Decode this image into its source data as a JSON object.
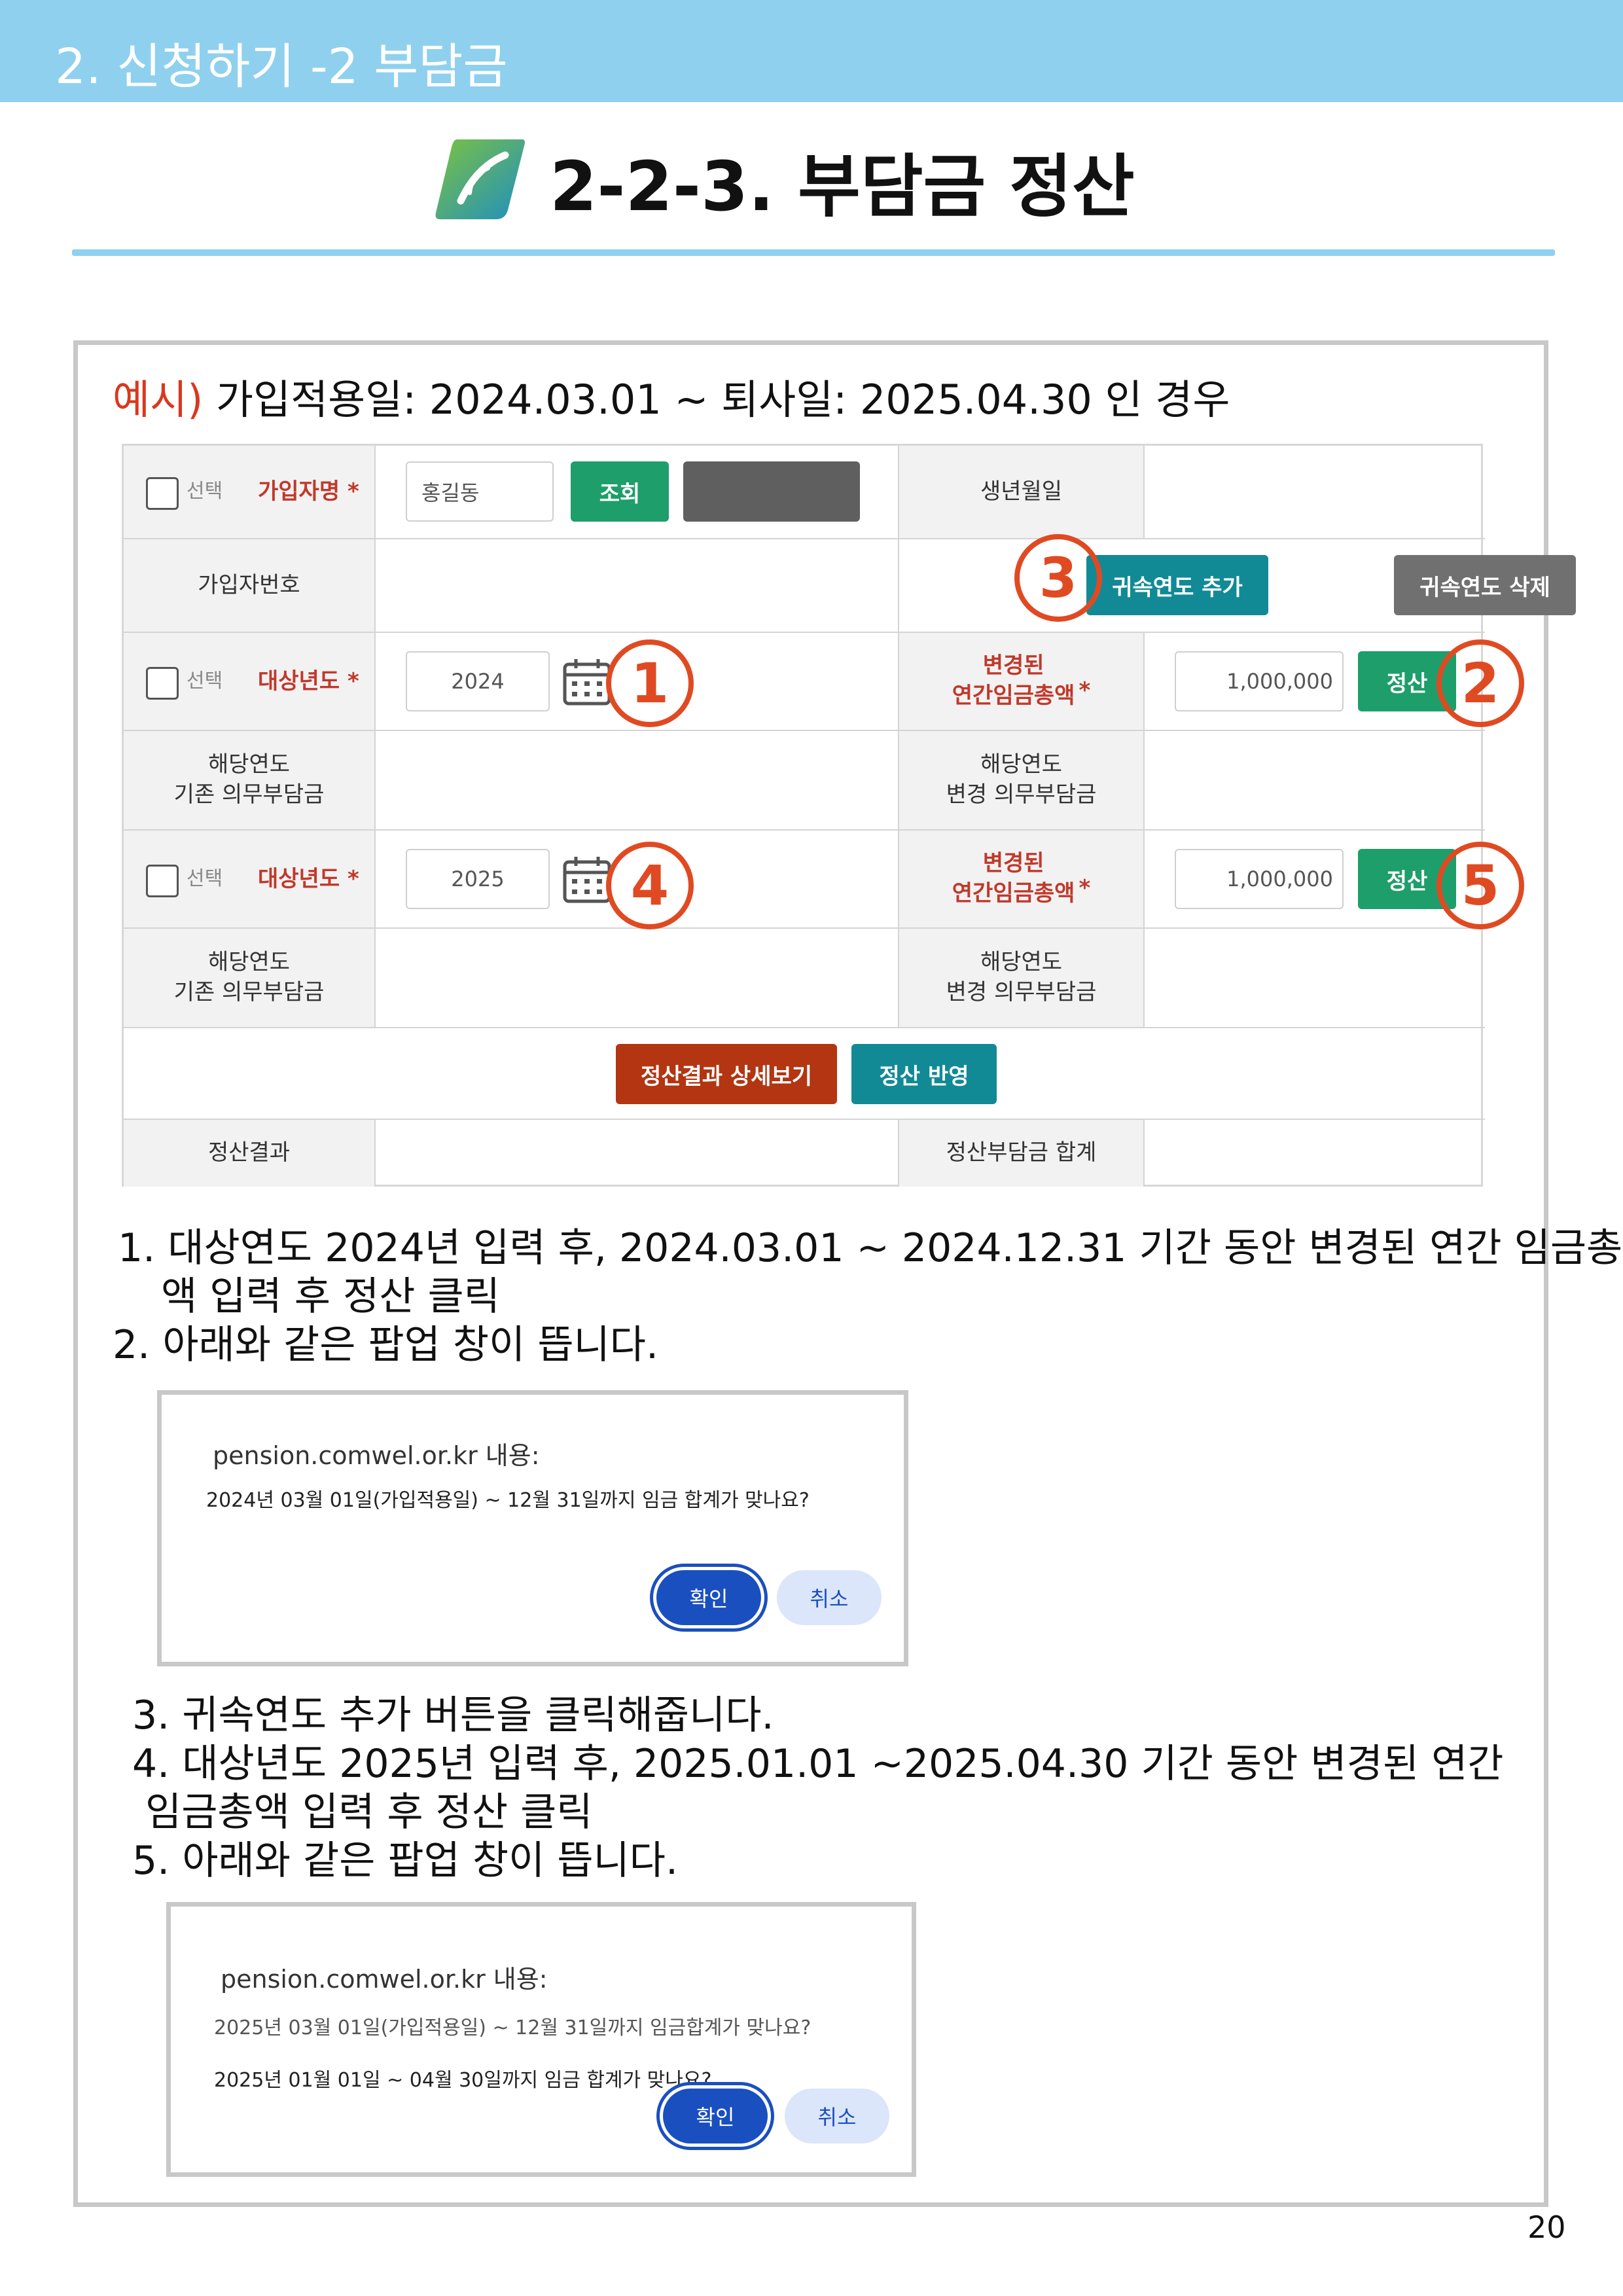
{
  "header": {
    "section_title": "2. 신청하기 -2 부담금",
    "page_title": "2-2-3. 부담금 정산"
  },
  "example": {
    "prefix": "예시)",
    "text": " 가입적용일: 2024.03.01 ~ 퇴사일: 2025.04.30 인 경우"
  },
  "form": {
    "select_label": "선택",
    "subscriber_name_label": "가입자명",
    "required_mark": "*",
    "subscriber_name_value": "홍길동",
    "search_button": "조회",
    "birth_date_label": "생년월일",
    "subscriber_number_label": "가입자번호",
    "add_year_button": "귀속연도 추가",
    "delete_year_button": "귀속연도 삭제",
    "target_year_label": "대상년도",
    "changed_wage_label": "변경된\n연간임금총액",
    "settle_button": "정산",
    "existing_burden_label": "해당연도\n기존 의무부담금",
    "changed_burden_label": "해당연도\n변경 의무부담금",
    "years": [
      {
        "year": "2024",
        "wage": "1,000,000"
      },
      {
        "year": "2025",
        "wage": "1,000,000"
      }
    ],
    "detail_button": "정산결과 상세보기",
    "apply_button": "정산 반영",
    "result_label": "정산결과",
    "total_label": "정산부담금 합계"
  },
  "annotations": [
    "1",
    "2",
    "3",
    "4",
    "5"
  ],
  "steps": {
    "s1_line1": "1. 대상연도 2024년 입력 후, 2024.03.01 ~ 2024.12.31 기간 동안 변경된 연간 임금총",
    "s1_line2": "액 입력 후 정산 클릭",
    "s2": "2. 아래와 같은 팝업 창이 뜹니다.",
    "s3": "3. 귀속연도 추가 버튼을 클릭해줍니다.",
    "s4_line1": "4. 대상년도 2025년 입력 후, 2025.01.01 ~2025.04.30 기간 동안 변경된 연간",
    "s4_line2": "임금총액 입력 후 정산 클릭",
    "s5": "5. 아래와 같은 팝업 창이 뜹니다."
  },
  "dialog1": {
    "host": "pension.comwel.or.kr 내용:",
    "message": "2024년 03월 01일(가입적용일) ~ 12월 31일까지 임금 합계가 맞나요?",
    "ok": "확인",
    "cancel": "취소"
  },
  "dialog2": {
    "host": "pension.comwel.or.kr 내용:",
    "old_message": "2025년 03월 01일(가입적용일) ~ 12월 31일까지 임금합계가 맞나요?",
    "message": "2025년 01월 01일 ~ 04월 30일까지 임금 합계가 맞나요?",
    "ok": "확인",
    "cancel": "취소"
  },
  "page_number": "20",
  "colors": {
    "header_bar": "#8fd0ee",
    "annotation": "#e04a22",
    "green_button": "#1e9e6a",
    "teal_button": "#118a96",
    "rust_button": "#b33512",
    "required_red": "#c0392b",
    "dialog_blue": "#1a4fc0"
  }
}
